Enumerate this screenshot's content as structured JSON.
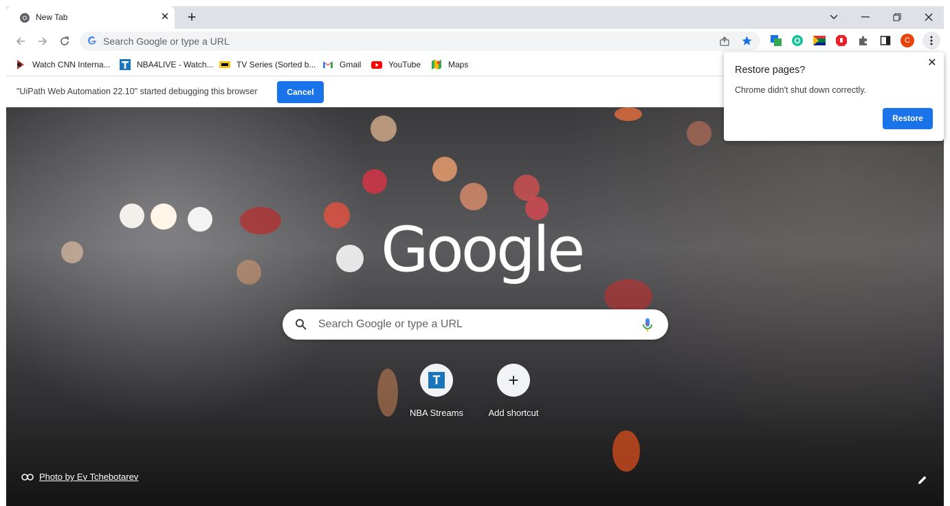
{
  "tab": {
    "title": "New Tab",
    "close_glyph": "✕",
    "icon": "chrome-icon"
  },
  "new_tab_glyph": "+",
  "omnibox": {
    "placeholder": "Search Google or type a URL"
  },
  "bookmarks": [
    {
      "label": "Watch CNN Interna...",
      "icon": "cnn-icon"
    },
    {
      "label": "NBA4LIVE - Watch...",
      "icon": "nba4live-icon"
    },
    {
      "label": "TV Series (Sorted b...",
      "icon": "imdb-icon"
    },
    {
      "label": "Gmail",
      "icon": "gmail-icon"
    },
    {
      "label": "YouTube",
      "icon": "youtube-icon"
    },
    {
      "label": "Maps",
      "icon": "maps-icon"
    }
  ],
  "infobar": {
    "message": "\"UiPath Web Automation 22.10\" started debugging this browser",
    "cancel_label": "Cancel"
  },
  "ntp": {
    "logo_text": "Google",
    "search_placeholder": "Search Google or type a URL",
    "shortcuts": [
      {
        "label": "NBA Streams",
        "glyph": "T"
      },
      {
        "label": "Add shortcut",
        "glyph": "+"
      }
    ],
    "attribution": "Photo by Ev Tchebotarev"
  },
  "restore": {
    "title": "Restore pages?",
    "message": "Chrome didn't shut down correctly.",
    "button_label": "Restore",
    "close_glyph": "✕"
  },
  "profile": {
    "initial": "C"
  },
  "colors": {
    "accent": "#1a73e8",
    "tabstrip": "#dee1e6",
    "profile": "#e8430c"
  }
}
